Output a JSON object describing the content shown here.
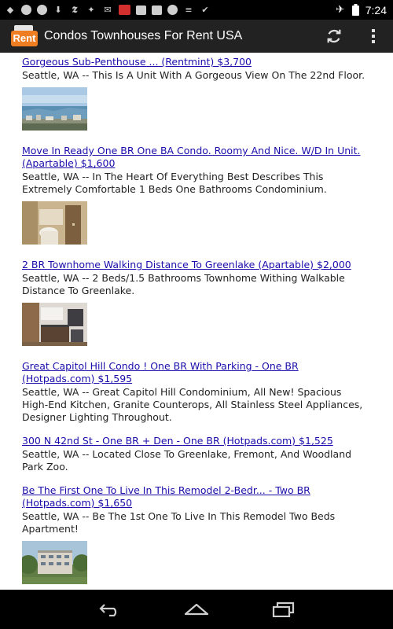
{
  "status_bar": {
    "time": "7:24",
    "left_icons": [
      "android-icon",
      "chat-icon",
      "chat-icon",
      "download-icon",
      "nyt-icon",
      "twitter-icon",
      "gmail-icon",
      "news-icon",
      "image-icon",
      "bag-icon",
      "spotify-icon",
      "stack-icon",
      "check-icon"
    ],
    "right_icons": [
      "airplane-icon",
      "battery-icon"
    ]
  },
  "app_bar": {
    "logo_text": "Rent",
    "title": "Condos Townhouses For Rent USA",
    "actions": [
      "refresh-icon",
      "overflow-menu-icon"
    ]
  },
  "listings": [
    {
      "title": "Gorgeous Sub-Penthouse ... (Rentmint) $3,700",
      "description": "Seattle, WA -- This Is A Unit With A Gorgeous View On The 22nd Floor.",
      "image": "city-view-photo"
    },
    {
      "title": "Move In Ready One BR One BA Condo. Roomy And Nice. W/D In Unit. (Apartable) $1,600",
      "description": "Seattle, WA -- In The Heart Of Everything Best Describes This Extremely Comfortable 1 Beds One Bathrooms Condominium.",
      "image": "bathroom-photo"
    },
    {
      "title": "2 BR Townhome Walking Distance To Greenlake (Apartable) $2,000",
      "description": "Seattle, WA -- 2 Beds/1.5 Bathrooms Townhome Withing Walkable Distance To Greenlake.",
      "image": "kitchen-photo"
    },
    {
      "title": "Great Capitol Hill Condo ! One BR With Parking - One BR (Hotpads.com) $1,595",
      "description": "Seattle, WA -- Great Capitol Hill Condominium, All New! Spacious High-End Kitchen, Granite Counterops, All Stainless Steel Appliances, Designer Lighting Throughout.",
      "image": ""
    },
    {
      "title": "300 N 42nd St - One BR + Den - One BR (Hotpads.com) $1,525",
      "description": "Seattle, WA -- Located Close To Greenlake, Fremont, And Woodland Park Zoo.",
      "image": ""
    },
    {
      "title": "Be The First One To Live In This Remodel 2-Bedr... - Two BR (Hotpads.com) $1,650",
      "description": "Seattle, WA -- Be The 1st One To Live In This Remodel Two Beds Apartment!",
      "image": "building-photo"
    }
  ],
  "nav_bar": {
    "buttons": [
      "back-icon",
      "home-icon",
      "recents-icon"
    ]
  },
  "colors": {
    "link": "#1a0dab",
    "action_bar": "#222222",
    "logo_orange": "#ef7d22"
  }
}
